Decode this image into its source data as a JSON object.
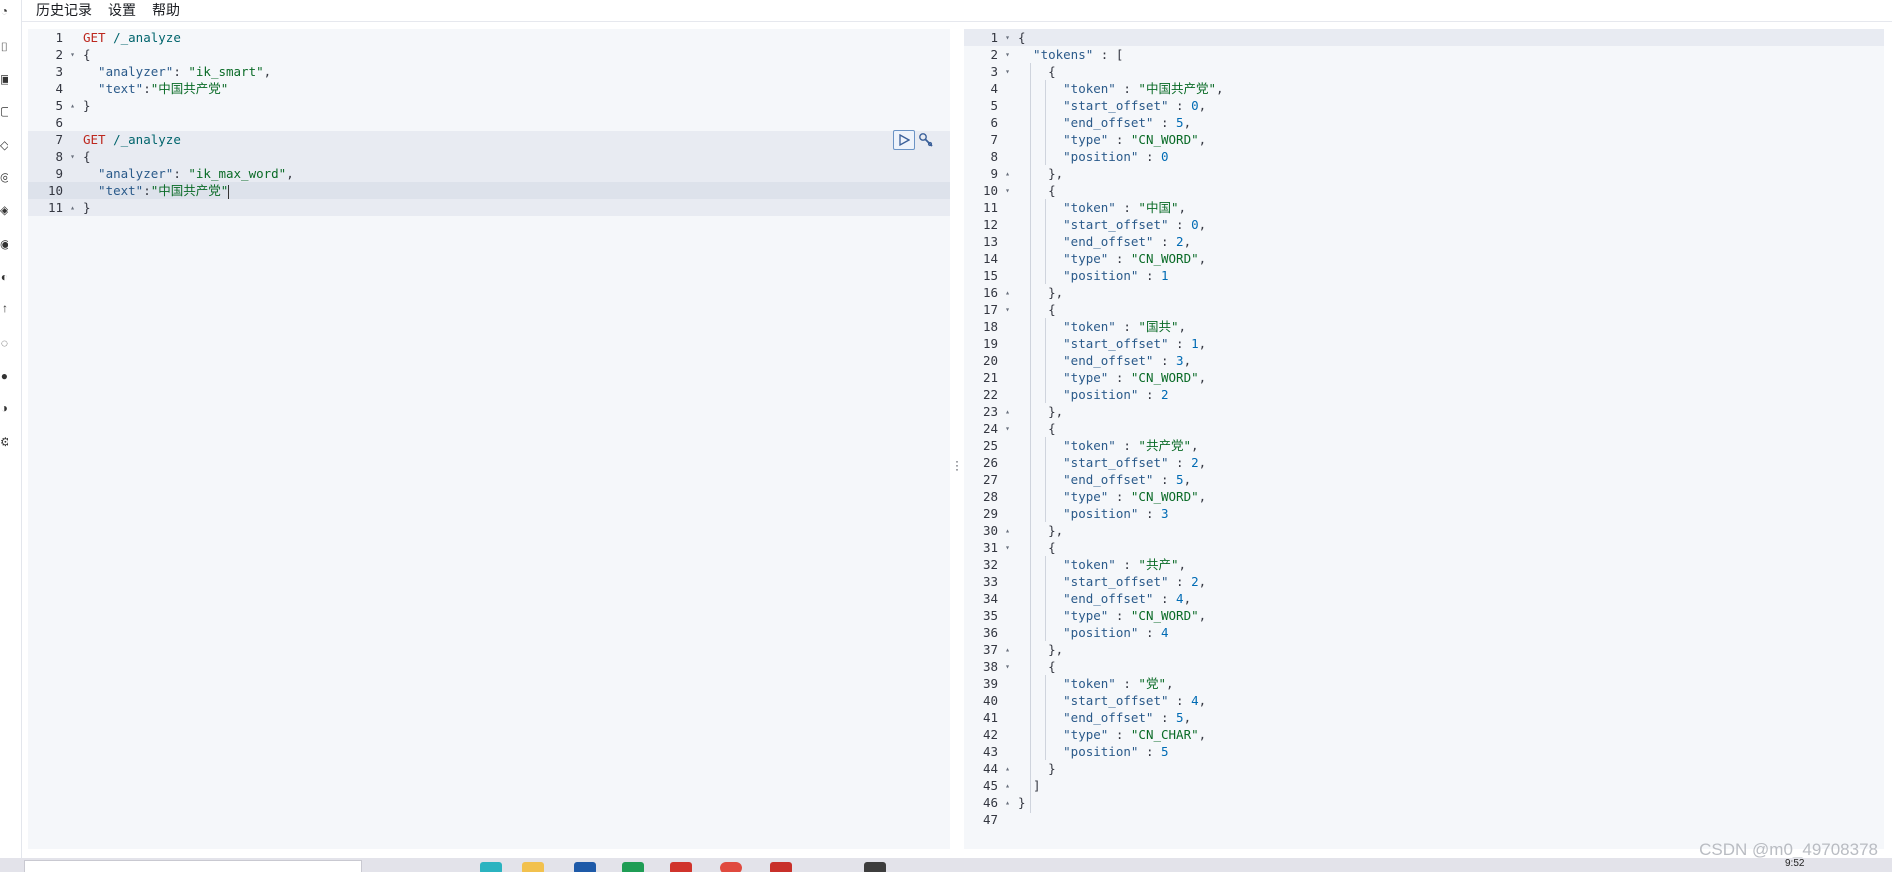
{
  "menu": {
    "history": "历史记录",
    "settings": "设置",
    "help": "帮助"
  },
  "request": {
    "lines": [
      [
        {
          "t": "GET ",
          "c": "method"
        },
        {
          "t": "/_analyze",
          "c": "path"
        }
      ],
      [
        {
          "t": "{",
          "c": "punct"
        }
      ],
      [
        {
          "t": "  \"analyzer\"",
          "c": "key"
        },
        {
          "t": ": ",
          "c": "punct"
        },
        {
          "t": "\"ik_smart\"",
          "c": "str"
        },
        {
          "t": ",",
          "c": "punct"
        }
      ],
      [
        {
          "t": "  \"text\"",
          "c": "key"
        },
        {
          "t": ":",
          "c": "punct"
        },
        {
          "t": "\"中国共产党\"",
          "c": "str"
        }
      ],
      [
        {
          "t": "}",
          "c": "punct"
        }
      ],
      [],
      [
        {
          "t": "GET ",
          "c": "method"
        },
        {
          "t": "/_analyze",
          "c": "path"
        }
      ],
      [
        {
          "t": "{",
          "c": "punct"
        }
      ],
      [
        {
          "t": "  \"analyzer\"",
          "c": "key"
        },
        {
          "t": ": ",
          "c": "punct"
        },
        {
          "t": "\"ik_max_word\"",
          "c": "str"
        },
        {
          "t": ",",
          "c": "punct"
        }
      ],
      [
        {
          "t": "  \"text\"",
          "c": "key"
        },
        {
          "t": ":",
          "c": "punct"
        },
        {
          "t": "\"中国共产党\"",
          "c": "str"
        },
        {
          "t": "",
          "c": "cursor"
        }
      ],
      [
        {
          "t": "}",
          "c": "punct"
        }
      ]
    ],
    "folds": {
      "2": "down",
      "5": "up",
      "8": "down",
      "11": "up"
    }
  },
  "response": {
    "lines": [
      [
        {
          "t": "{",
          "c": "punct"
        }
      ],
      [
        {
          "t": "  \"tokens\"",
          "c": "key"
        },
        {
          "t": " : [",
          "c": "punct"
        }
      ],
      [
        {
          "t": "    {",
          "c": "punct"
        }
      ],
      [
        {
          "t": "      \"token\"",
          "c": "key"
        },
        {
          "t": " : ",
          "c": "punct"
        },
        {
          "t": "\"中国共产党\"",
          "c": "str"
        },
        {
          "t": ",",
          "c": "punct"
        }
      ],
      [
        {
          "t": "      \"start_offset\"",
          "c": "key"
        },
        {
          "t": " : ",
          "c": "punct"
        },
        {
          "t": "0",
          "c": "num"
        },
        {
          "t": ",",
          "c": "punct"
        }
      ],
      [
        {
          "t": "      \"end_offset\"",
          "c": "key"
        },
        {
          "t": " : ",
          "c": "punct"
        },
        {
          "t": "5",
          "c": "num"
        },
        {
          "t": ",",
          "c": "punct"
        }
      ],
      [
        {
          "t": "      \"type\"",
          "c": "key"
        },
        {
          "t": " : ",
          "c": "punct"
        },
        {
          "t": "\"CN_WORD\"",
          "c": "str"
        },
        {
          "t": ",",
          "c": "punct"
        }
      ],
      [
        {
          "t": "      \"position\"",
          "c": "key"
        },
        {
          "t": " : ",
          "c": "punct"
        },
        {
          "t": "0",
          "c": "num"
        }
      ],
      [
        {
          "t": "    },",
          "c": "punct"
        }
      ],
      [
        {
          "t": "    {",
          "c": "punct"
        }
      ],
      [
        {
          "t": "      \"token\"",
          "c": "key"
        },
        {
          "t": " : ",
          "c": "punct"
        },
        {
          "t": "\"中国\"",
          "c": "str"
        },
        {
          "t": ",",
          "c": "punct"
        }
      ],
      [
        {
          "t": "      \"start_offset\"",
          "c": "key"
        },
        {
          "t": " : ",
          "c": "punct"
        },
        {
          "t": "0",
          "c": "num"
        },
        {
          "t": ",",
          "c": "punct"
        }
      ],
      [
        {
          "t": "      \"end_offset\"",
          "c": "key"
        },
        {
          "t": " : ",
          "c": "punct"
        },
        {
          "t": "2",
          "c": "num"
        },
        {
          "t": ",",
          "c": "punct"
        }
      ],
      [
        {
          "t": "      \"type\"",
          "c": "key"
        },
        {
          "t": " : ",
          "c": "punct"
        },
        {
          "t": "\"CN_WORD\"",
          "c": "str"
        },
        {
          "t": ",",
          "c": "punct"
        }
      ],
      [
        {
          "t": "      \"position\"",
          "c": "key"
        },
        {
          "t": " : ",
          "c": "punct"
        },
        {
          "t": "1",
          "c": "num"
        }
      ],
      [
        {
          "t": "    },",
          "c": "punct"
        }
      ],
      [
        {
          "t": "    {",
          "c": "punct"
        }
      ],
      [
        {
          "t": "      \"token\"",
          "c": "key"
        },
        {
          "t": " : ",
          "c": "punct"
        },
        {
          "t": "\"国共\"",
          "c": "str"
        },
        {
          "t": ",",
          "c": "punct"
        }
      ],
      [
        {
          "t": "      \"start_offset\"",
          "c": "key"
        },
        {
          "t": " : ",
          "c": "punct"
        },
        {
          "t": "1",
          "c": "num"
        },
        {
          "t": ",",
          "c": "punct"
        }
      ],
      [
        {
          "t": "      \"end_offset\"",
          "c": "key"
        },
        {
          "t": " : ",
          "c": "punct"
        },
        {
          "t": "3",
          "c": "num"
        },
        {
          "t": ",",
          "c": "punct"
        }
      ],
      [
        {
          "t": "      \"type\"",
          "c": "key"
        },
        {
          "t": " : ",
          "c": "punct"
        },
        {
          "t": "\"CN_WORD\"",
          "c": "str"
        },
        {
          "t": ",",
          "c": "punct"
        }
      ],
      [
        {
          "t": "      \"position\"",
          "c": "key"
        },
        {
          "t": " : ",
          "c": "punct"
        },
        {
          "t": "2",
          "c": "num"
        }
      ],
      [
        {
          "t": "    },",
          "c": "punct"
        }
      ],
      [
        {
          "t": "    {",
          "c": "punct"
        }
      ],
      [
        {
          "t": "      \"token\"",
          "c": "key"
        },
        {
          "t": " : ",
          "c": "punct"
        },
        {
          "t": "\"共产党\"",
          "c": "str"
        },
        {
          "t": ",",
          "c": "punct"
        }
      ],
      [
        {
          "t": "      \"start_offset\"",
          "c": "key"
        },
        {
          "t": " : ",
          "c": "punct"
        },
        {
          "t": "2",
          "c": "num"
        },
        {
          "t": ",",
          "c": "punct"
        }
      ],
      [
        {
          "t": "      \"end_offset\"",
          "c": "key"
        },
        {
          "t": " : ",
          "c": "punct"
        },
        {
          "t": "5",
          "c": "num"
        },
        {
          "t": ",",
          "c": "punct"
        }
      ],
      [
        {
          "t": "      \"type\"",
          "c": "key"
        },
        {
          "t": " : ",
          "c": "punct"
        },
        {
          "t": "\"CN_WORD\"",
          "c": "str"
        },
        {
          "t": ",",
          "c": "punct"
        }
      ],
      [
        {
          "t": "      \"position\"",
          "c": "key"
        },
        {
          "t": " : ",
          "c": "punct"
        },
        {
          "t": "3",
          "c": "num"
        }
      ],
      [
        {
          "t": "    },",
          "c": "punct"
        }
      ],
      [
        {
          "t": "    {",
          "c": "punct"
        }
      ],
      [
        {
          "t": "      \"token\"",
          "c": "key"
        },
        {
          "t": " : ",
          "c": "punct"
        },
        {
          "t": "\"共产\"",
          "c": "str"
        },
        {
          "t": ",",
          "c": "punct"
        }
      ],
      [
        {
          "t": "      \"start_offset\"",
          "c": "key"
        },
        {
          "t": " : ",
          "c": "punct"
        },
        {
          "t": "2",
          "c": "num"
        },
        {
          "t": ",",
          "c": "punct"
        }
      ],
      [
        {
          "t": "      \"end_offset\"",
          "c": "key"
        },
        {
          "t": " : ",
          "c": "punct"
        },
        {
          "t": "4",
          "c": "num"
        },
        {
          "t": ",",
          "c": "punct"
        }
      ],
      [
        {
          "t": "      \"type\"",
          "c": "key"
        },
        {
          "t": " : ",
          "c": "punct"
        },
        {
          "t": "\"CN_WORD\"",
          "c": "str"
        },
        {
          "t": ",",
          "c": "punct"
        }
      ],
      [
        {
          "t": "      \"position\"",
          "c": "key"
        },
        {
          "t": " : ",
          "c": "punct"
        },
        {
          "t": "4",
          "c": "num"
        }
      ],
      [
        {
          "t": "    },",
          "c": "punct"
        }
      ],
      [
        {
          "t": "    {",
          "c": "punct"
        }
      ],
      [
        {
          "t": "      \"token\"",
          "c": "key"
        },
        {
          "t": " : ",
          "c": "punct"
        },
        {
          "t": "\"党\"",
          "c": "str"
        },
        {
          "t": ",",
          "c": "punct"
        }
      ],
      [
        {
          "t": "      \"start_offset\"",
          "c": "key"
        },
        {
          "t": " : ",
          "c": "punct"
        },
        {
          "t": "4",
          "c": "num"
        },
        {
          "t": ",",
          "c": "punct"
        }
      ],
      [
        {
          "t": "      \"end_offset\"",
          "c": "key"
        },
        {
          "t": " : ",
          "c": "punct"
        },
        {
          "t": "5",
          "c": "num"
        },
        {
          "t": ",",
          "c": "punct"
        }
      ],
      [
        {
          "t": "      \"type\"",
          "c": "key"
        },
        {
          "t": " : ",
          "c": "punct"
        },
        {
          "t": "\"CN_CHAR\"",
          "c": "str"
        },
        {
          "t": ",",
          "c": "punct"
        }
      ],
      [
        {
          "t": "      \"position\"",
          "c": "key"
        },
        {
          "t": " : ",
          "c": "punct"
        },
        {
          "t": "5",
          "c": "num"
        }
      ],
      [
        {
          "t": "    }",
          "c": "punct"
        }
      ],
      [
        {
          "t": "  ]",
          "c": "punct"
        }
      ],
      [
        {
          "t": "}",
          "c": "punct"
        }
      ],
      []
    ],
    "folds": {
      "1": "down",
      "2": "down",
      "3": "down",
      "9": "up",
      "10": "down",
      "16": "up",
      "17": "down",
      "23": "up",
      "24": "down",
      "30": "up",
      "31": "down",
      "37": "up",
      "38": "down",
      "44": "up",
      "45": "up",
      "46": "up"
    }
  },
  "watermark": "CSDN @m0_49708378",
  "clock": "9:52",
  "colors": {
    "method": "#bd271e",
    "path": "#00646c",
    "key": "#2a5a8a",
    "str": "#0a6b27",
    "num": "#006bb4",
    "editor_bg": "#f5f7fa",
    "accent": "#6b93c5"
  },
  "icons": [
    "run-icon",
    "wrench-icon",
    "splitter-dots-icon"
  ]
}
